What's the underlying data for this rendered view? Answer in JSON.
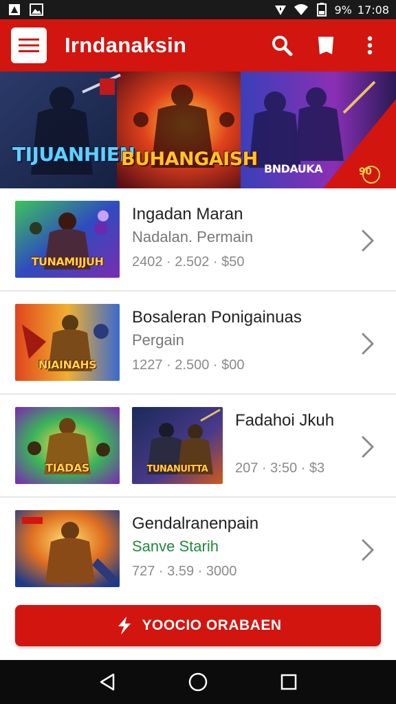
{
  "status_bar": {
    "battery_text": "9%",
    "time": "17:08",
    "icons": [
      "notification-a-icon",
      "image-icon",
      "wifi-icon",
      "signal-icon",
      "battery-icon"
    ]
  },
  "app_bar": {
    "title": "Irndanaksin",
    "icons": [
      "menu-icon",
      "search-icon",
      "tag-icon",
      "more-vert-icon"
    ]
  },
  "banner": {
    "left_title": "TIJUANHIEN",
    "center_title": "BUHANGAISH",
    "right_title": "BNDAUKA",
    "corner_text": "90"
  },
  "games": [
    {
      "title": "Ingadan Maran",
      "subtitle": "Nadalan. Permain",
      "meta": "2402 · 2.502 · $50",
      "thumb_label": "TUNAMIJJUH",
      "subtitle_color": "#777777"
    },
    {
      "title": "Bosaleran Ponigainuas",
      "subtitle": "Pergain",
      "meta": "1227 · 2.500 · $00",
      "thumb_label": "NIAINAHS",
      "subtitle_color": "#777777"
    },
    {
      "title": "Fadahoi Jkuh",
      "subtitle": "",
      "meta": "207 · 3:50 · $3",
      "thumb_label": "TIADAS",
      "thumb2_label": "TUNANUITTA",
      "subtitle_color": "#777777"
    },
    {
      "title": "Gendalranenpain",
      "subtitle": "Sanve Starih",
      "meta": "727 · 3.59 · 3000",
      "thumb_label": "",
      "subtitle_color": "#1f8a3a"
    }
  ],
  "cta": {
    "label": "YOOCIO ORABAEN",
    "icon": "lightning-icon"
  },
  "nav_bar": {
    "icons": [
      "back-icon",
      "home-icon",
      "recents-icon"
    ]
  },
  "colors": {
    "primary": "#d2150f",
    "status_bar": "#1a1a1a",
    "nav_bar": "#0c0c0c",
    "green_text": "#1f8a3a"
  }
}
